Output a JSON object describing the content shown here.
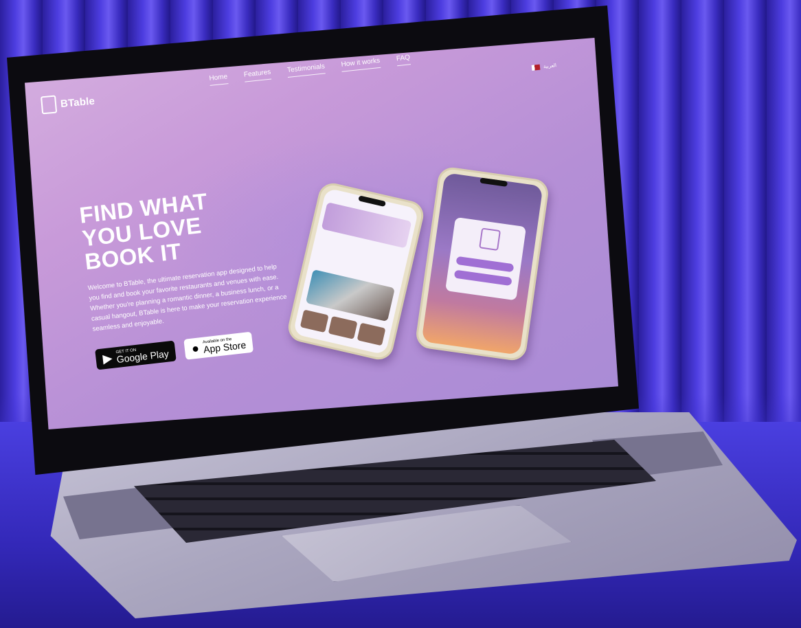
{
  "site": {
    "brand": "BTable",
    "nav": [
      "Home",
      "Features",
      "Testimonials",
      "How it works",
      "FAQ"
    ],
    "language": "العربية",
    "hero": {
      "headline_lines": [
        "FIND WHAT",
        "YOU LOVE",
        "BOOK IT"
      ],
      "description": "Welcome to BTable, the ultimate reservation app designed to help you find and book your favorite restaurants and venues with ease. Whether you're planning a romantic dinner, a business lunch, or a casual hangout, BTable is here to make your reservation experience seamless and enjoyable."
    },
    "stores": {
      "google": {
        "small": "GET IT ON",
        "big": "Google Play"
      },
      "apple": {
        "small": "Available on the",
        "big": "App Store"
      }
    }
  },
  "colors": {
    "screen_bg": "#c89ad9",
    "backdrop": "#3a2fc4",
    "accent": "#a06fd4"
  }
}
